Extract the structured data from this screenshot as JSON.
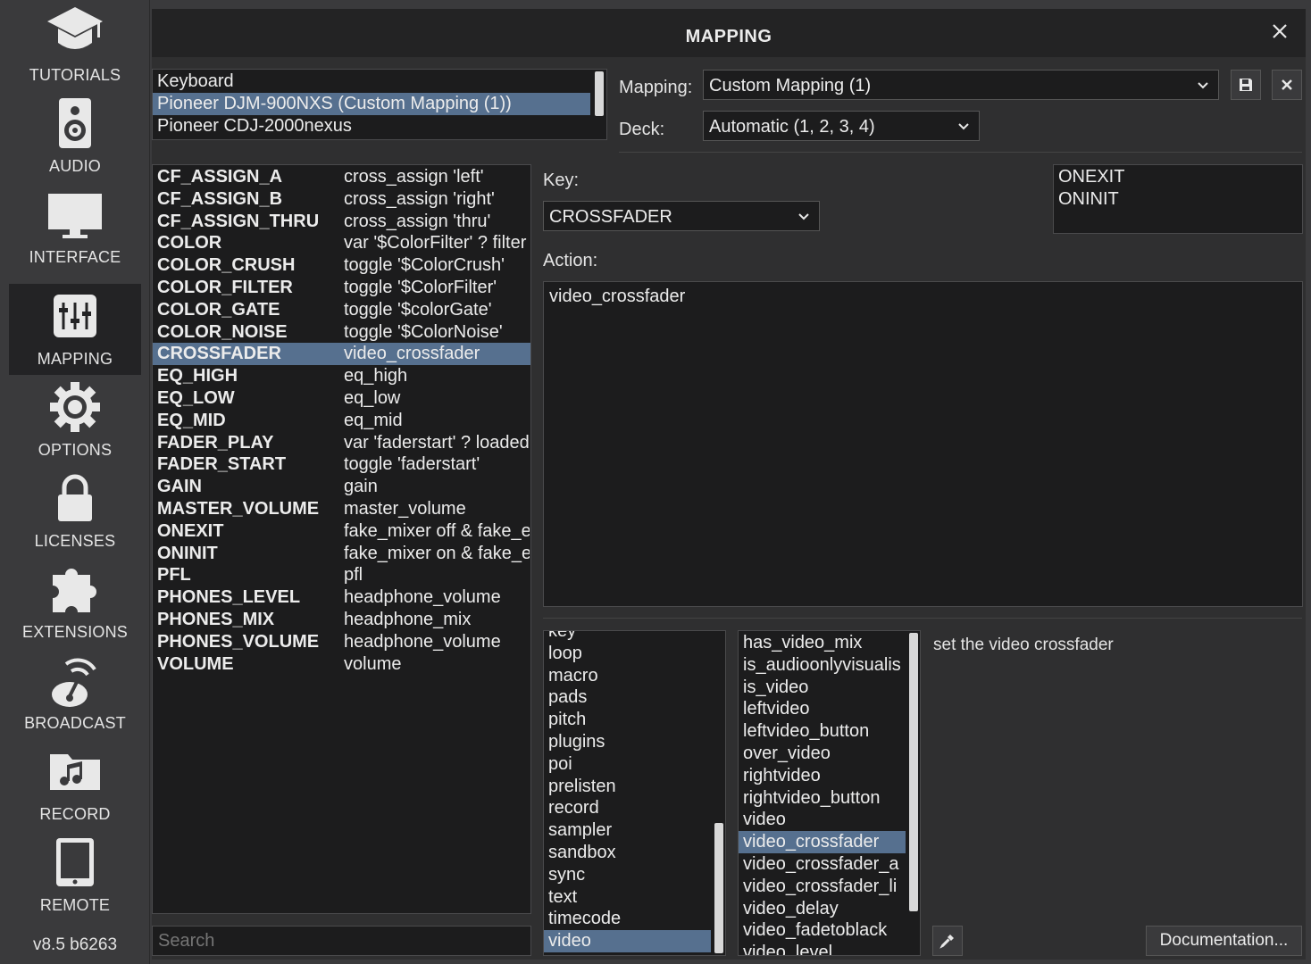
{
  "sidebar": {
    "items": [
      {
        "label": "TUTORIALS",
        "icon": "graduation-cap-icon"
      },
      {
        "label": "AUDIO",
        "icon": "speaker-icon"
      },
      {
        "label": "INTERFACE",
        "icon": "monitor-icon"
      },
      {
        "label": "MAPPING",
        "icon": "mixer-sliders-icon",
        "active": true
      },
      {
        "label": "OPTIONS",
        "icon": "gear-icon"
      },
      {
        "label": "LICENSES",
        "icon": "lock-icon"
      },
      {
        "label": "EXTENSIONS",
        "icon": "puzzle-icon"
      },
      {
        "label": "BROADCAST",
        "icon": "broadcast-icon"
      },
      {
        "label": "RECORD",
        "icon": "music-folder-icon"
      },
      {
        "label": "REMOTE",
        "icon": "tablet-icon"
      }
    ],
    "version": "v8.5 b6263"
  },
  "dialog": {
    "title": "MAPPING",
    "devices": [
      "Keyboard",
      "Pioneer DJM-900NXS (Custom Mapping (1))",
      "Pioneer CDJ-2000nexus"
    ],
    "selected_device": 1,
    "mapping_label": "Mapping:",
    "mapping_value": "Custom Mapping (1)",
    "deck_label": "Deck:",
    "deck_value": "Automatic (1, 2, 3, 4)",
    "key_label": "Key:",
    "key_value": "CROSSFADER",
    "action_label": "Action:",
    "action_value": "video_crossfader",
    "extra_keys": [
      "ONEXIT",
      "ONINIT"
    ],
    "mappings": [
      {
        "key": "CF_ASSIGN_A",
        "action": "cross_assign 'left'"
      },
      {
        "key": "CF_ASSIGN_B",
        "action": "cross_assign 'right'"
      },
      {
        "key": "CF_ASSIGN_THRU",
        "action": "cross_assign 'thru'"
      },
      {
        "key": "COLOR",
        "action": "var '$ColorFilter' ? filter"
      },
      {
        "key": "COLOR_CRUSH",
        "action": "toggle '$ColorCrush'"
      },
      {
        "key": "COLOR_FILTER",
        "action": "toggle '$ColorFilter'"
      },
      {
        "key": "COLOR_GATE",
        "action": "toggle '$colorGate'"
      },
      {
        "key": "COLOR_NOISE",
        "action": "toggle '$ColorNoise'"
      },
      {
        "key": "CROSSFADER",
        "action": "video_crossfader"
      },
      {
        "key": "EQ_HIGH",
        "action": "eq_high"
      },
      {
        "key": "EQ_LOW",
        "action": "eq_low"
      },
      {
        "key": "EQ_MID",
        "action": "eq_mid"
      },
      {
        "key": "FADER_PLAY",
        "action": "var 'faderstart' ? loaded"
      },
      {
        "key": "FADER_START",
        "action": "toggle 'faderstart'"
      },
      {
        "key": "GAIN",
        "action": "gain"
      },
      {
        "key": "MASTER_VOLUME",
        "action": "master_volume"
      },
      {
        "key": "ONEXIT",
        "action": "fake_mixer off & fake_e"
      },
      {
        "key": "ONINIT",
        "action": "fake_mixer on & fake_e"
      },
      {
        "key": "PFL",
        "action": "pfl"
      },
      {
        "key": "PHONES_LEVEL",
        "action": "headphone_volume"
      },
      {
        "key": "PHONES_MIX",
        "action": "headphone_mix"
      },
      {
        "key": "PHONES_VOLUME",
        "action": "headphone_volume"
      },
      {
        "key": "VOLUME",
        "action": "volume"
      }
    ],
    "selected_mapping": 8,
    "search_placeholder": "Search",
    "categories": [
      "key",
      "loop",
      "macro",
      "pads",
      "pitch",
      "plugins",
      "poi",
      "prelisten",
      "record",
      "sampler",
      "sandbox",
      "sync",
      "text",
      "timecode",
      "video"
    ],
    "selected_category": 14,
    "verbs": [
      "has_video_mix",
      "is_audioonlyvisualis",
      "is_video",
      "leftvideo",
      "leftvideo_button",
      "over_video",
      "rightvideo",
      "rightvideo_button",
      "video",
      "video_crossfader",
      "video_crossfader_a",
      "video_crossfader_li",
      "video_delay",
      "video_fadetoblack",
      "video_level"
    ],
    "selected_verb": 9,
    "verb_description": "set the video crossfader",
    "documentation_label": "Documentation..."
  },
  "colors": {
    "selection": "#56708f",
    "panel": "#2f2f30",
    "list_bg": "#1c1c1d"
  }
}
